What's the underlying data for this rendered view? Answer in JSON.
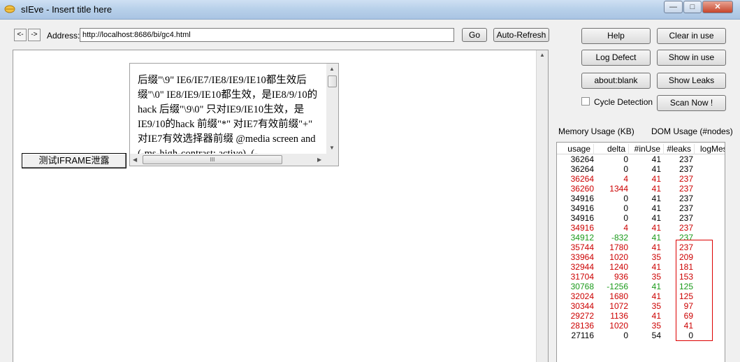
{
  "window": {
    "title": "sIEve - Insert title here",
    "controls": {
      "minimize": "—",
      "maximize": "□",
      "close": "✕"
    }
  },
  "toolbar": {
    "back": "<-",
    "forward": "->",
    "address_label": "Address:",
    "address_value": "http://localhost:8686/bi/gc4.html",
    "go": "Go",
    "auto_refresh": "Auto-Refresh"
  },
  "panel": {
    "help": "Help",
    "clear_in_use": "Clear in use",
    "log_defect": "Log Defect",
    "show_in_use": "Show in use",
    "about_blank": "about:blank",
    "show_leaks": "Show Leaks",
    "cycle_detection": "Cycle Detection",
    "scan_now": "Scan Now !",
    "memory_usage": "Memory Usage (KB)",
    "dom_usage": "DOM Usage (#nodes)"
  },
  "page": {
    "test_button": "测试IFRAME泄露",
    "iframe_text": "后缀\"\\9\" IE6/IE7/IE8/IE9/IE10都生效后缀\"\\0\" IE8/IE9/IE10都生效，是IE8/9/10的hack 后缀\"\\9\\0\" 只对IE9/IE10生效，是IE9/10的hack 前缀\"*\" 对IE7有效前缀\"+\" 对IE7有效选择器前缀  @media screen and (-ms-high-contrast: active), (-",
    "hscroll_grip": "III"
  },
  "table": {
    "columns": [
      "usage",
      "delta",
      "#inUse",
      "#leaks",
      "logMes"
    ],
    "colors": {
      "black": "#000000",
      "red": "#cc0000",
      "green": "#1a9a1a"
    },
    "rows": [
      {
        "usage": "36264",
        "delta": "0",
        "inUse": "41",
        "leaks": "237",
        "color": "black"
      },
      {
        "usage": "36264",
        "delta": "0",
        "inUse": "41",
        "leaks": "237",
        "color": "black"
      },
      {
        "usage": "36264",
        "delta": "4",
        "inUse": "41",
        "leaks": "237",
        "color": "red"
      },
      {
        "usage": "36260",
        "delta": "1344",
        "inUse": "41",
        "leaks": "237",
        "color": "red"
      },
      {
        "usage": "34916",
        "delta": "0",
        "inUse": "41",
        "leaks": "237",
        "color": "black"
      },
      {
        "usage": "34916",
        "delta": "0",
        "inUse": "41",
        "leaks": "237",
        "color": "black"
      },
      {
        "usage": "34916",
        "delta": "0",
        "inUse": "41",
        "leaks": "237",
        "color": "black"
      },
      {
        "usage": "34916",
        "delta": "4",
        "inUse": "41",
        "leaks": "237",
        "color": "red"
      },
      {
        "usage": "34912",
        "delta": "-832",
        "inUse": "41",
        "leaks": "237",
        "color": "green"
      },
      {
        "usage": "35744",
        "delta": "1780",
        "inUse": "41",
        "leaks": "237",
        "color": "red"
      },
      {
        "usage": "33964",
        "delta": "1020",
        "inUse": "35",
        "leaks": "209",
        "color": "red"
      },
      {
        "usage": "32944",
        "delta": "1240",
        "inUse": "41",
        "leaks": "181",
        "color": "red"
      },
      {
        "usage": "31704",
        "delta": "936",
        "inUse": "35",
        "leaks": "153",
        "color": "red"
      },
      {
        "usage": "30768",
        "delta": "-1256",
        "inUse": "41",
        "leaks": "125",
        "color": "green"
      },
      {
        "usage": "32024",
        "delta": "1680",
        "inUse": "41",
        "leaks": "125",
        "color": "red"
      },
      {
        "usage": "30344",
        "delta": "1072",
        "inUse": "35",
        "leaks": "97",
        "color": "red"
      },
      {
        "usage": "29272",
        "delta": "1136",
        "inUse": "41",
        "leaks": "69",
        "color": "red"
      },
      {
        "usage": "28136",
        "delta": "1020",
        "inUse": "35",
        "leaks": "41",
        "color": "red"
      },
      {
        "usage": "27116",
        "delta": "0",
        "inUse": "54",
        "leaks": "0",
        "color": "black"
      }
    ]
  }
}
